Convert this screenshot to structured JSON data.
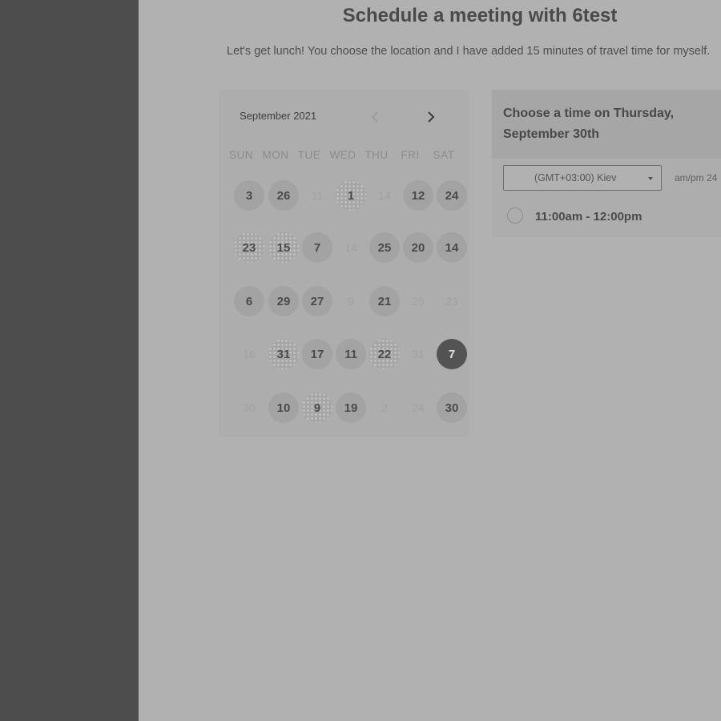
{
  "page": {
    "title": "Schedule a meeting with 6test",
    "description": "Let's get lunch! You choose the location and I have added 15 minutes of travel time for myself."
  },
  "calendar": {
    "month_label": "September 2021",
    "prev_icon": "chevron-left-icon",
    "next_icon": "chevron-right-icon",
    "weekdays": [
      "SUN",
      "MON",
      "TUE",
      "WED",
      "THU",
      "FRI",
      "SAT"
    ],
    "weeks": [
      [
        {
          "label": "3",
          "state": "available"
        },
        {
          "label": "26",
          "state": "available"
        },
        {
          "label": "11",
          "state": "disabled"
        },
        {
          "label": "1",
          "state": "pattern"
        },
        {
          "label": "14",
          "state": "disabled"
        },
        {
          "label": "12",
          "state": "available"
        },
        {
          "label": "24",
          "state": "available"
        }
      ],
      [
        {
          "label": "23",
          "state": "pattern"
        },
        {
          "label": "15",
          "state": "pattern"
        },
        {
          "label": "7",
          "state": "available"
        },
        {
          "label": "14",
          "state": "disabled"
        },
        {
          "label": "25",
          "state": "available"
        },
        {
          "label": "20",
          "state": "available"
        },
        {
          "label": "14",
          "state": "available"
        }
      ],
      [
        {
          "label": "6",
          "state": "available"
        },
        {
          "label": "29",
          "state": "available"
        },
        {
          "label": "27",
          "state": "available"
        },
        {
          "label": "9",
          "state": "disabled"
        },
        {
          "label": "21",
          "state": "available"
        },
        {
          "label": "25",
          "state": "disabled"
        },
        {
          "label": "23",
          "state": "disabled"
        }
      ],
      [
        {
          "label": "16",
          "state": "disabled"
        },
        {
          "label": "31",
          "state": "pattern"
        },
        {
          "label": "17",
          "state": "available"
        },
        {
          "label": "11",
          "state": "available"
        },
        {
          "label": "22",
          "state": "pattern"
        },
        {
          "label": "31",
          "state": "disabled"
        },
        {
          "label": "7",
          "state": "selected"
        }
      ],
      [
        {
          "label": "30",
          "state": "disabled"
        },
        {
          "label": "10",
          "state": "available"
        },
        {
          "label": "9",
          "state": "pattern"
        },
        {
          "label": "19",
          "state": "available"
        },
        {
          "label": "2",
          "state": "disabled"
        },
        {
          "label": "24",
          "state": "disabled"
        },
        {
          "label": "30",
          "state": "available"
        }
      ]
    ]
  },
  "time_panel": {
    "header": "Choose a time on Thursday, September 30th",
    "timezone": "(GMT+03:00) Kiev",
    "format_toggle": "am/pm  24",
    "slots": [
      {
        "label": "11:00am - 12:00pm"
      }
    ]
  },
  "colors": {
    "sidebar": "#4d4d4d",
    "background": "#b1b1b1",
    "selected_day": "#535353"
  }
}
